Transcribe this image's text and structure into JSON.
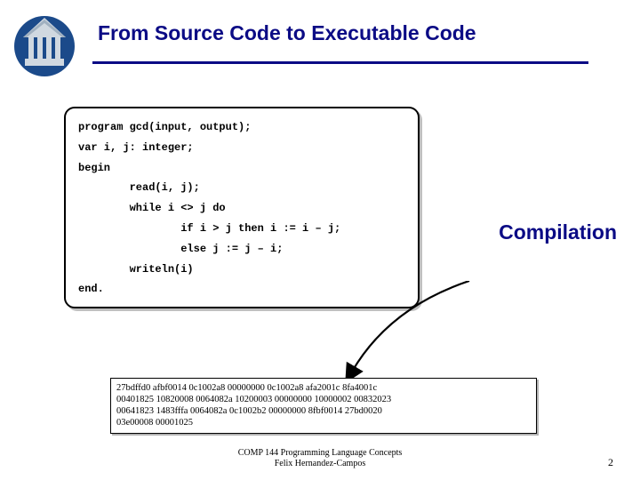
{
  "title": "From Source Code to Executable Code",
  "code": "program gcd(input, output);\nvar i, j: integer;\nbegin\n        read(i, j);\n        while i <> j do\n                if i > j then i := i – j;\n                else j := j – i;\n        writeln(i)\nend.",
  "label": "Compilation",
  "hex": "27bdffd0 afbf0014 0c1002a8 00000000 0c1002a8 afa2001c 8fa4001c\n00401825 10820008 0064082a 10200003 00000000 10000002 00832023\n00641823 1483fffa 0064082a 0c1002b2 00000000 8fbf0014 27bd0020\n03e00008 00001025",
  "footer_line1": "COMP 144 Programming Language Concepts",
  "footer_line2": "Felix Hernandez-Campos",
  "page": "2"
}
